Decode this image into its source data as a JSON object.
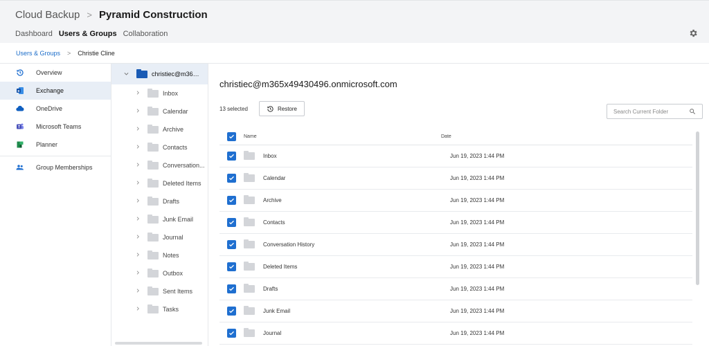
{
  "header": {
    "app_title": "Cloud Backup",
    "separator": ">",
    "org_name": "Pyramid Construction",
    "nav": [
      {
        "label": "Dashboard",
        "active": false
      },
      {
        "label": "Users & Groups",
        "active": true
      },
      {
        "label": "Collaboration",
        "active": false
      }
    ],
    "settings_icon": "gear-icon"
  },
  "breadcrumb": {
    "root": "Users & Groups",
    "separator": ">",
    "current": "Christie Cline"
  },
  "sidebar": {
    "items": [
      {
        "label": "Overview",
        "icon": "history-icon",
        "active": false
      },
      {
        "label": "Exchange",
        "icon": "exchange-icon",
        "active": true
      },
      {
        "label": "OneDrive",
        "icon": "cloud-icon",
        "active": false
      },
      {
        "label": "Microsoft Teams",
        "icon": "teams-icon",
        "active": false
      },
      {
        "label": "Planner",
        "icon": "planner-icon",
        "active": false
      }
    ],
    "secondary": [
      {
        "label": "Group Memberships",
        "icon": "people-icon",
        "active": false
      }
    ]
  },
  "tree": {
    "root_label": "christiec@m365...",
    "folders": [
      "Inbox",
      "Calendar",
      "Archive",
      "Contacts",
      "Conversation...",
      "Deleted Items",
      "Drafts",
      "Junk Email",
      "Journal",
      "Notes",
      "Outbox",
      "Sent Items",
      "Tasks"
    ]
  },
  "main": {
    "title": "christiec@m365x49430496.onmicrosoft.com",
    "selected_count": "13 selected",
    "restore_label": "Restore",
    "search_placeholder": "Search Current Folder",
    "columns": {
      "name": "Name",
      "date": "Date"
    },
    "rows": [
      {
        "name": "Inbox",
        "date": "Jun 19, 2023 1:44 PM"
      },
      {
        "name": "Calendar",
        "date": "Jun 19, 2023 1:44 PM"
      },
      {
        "name": "Archive",
        "date": "Jun 19, 2023 1:44 PM"
      },
      {
        "name": "Contacts",
        "date": "Jun 19, 2023 1:44 PM"
      },
      {
        "name": "Conversation History",
        "date": "Jun 19, 2023 1:44 PM"
      },
      {
        "name": "Deleted Items",
        "date": "Jun 19, 2023 1:44 PM"
      },
      {
        "name": "Drafts",
        "date": "Jun 19, 2023 1:44 PM"
      },
      {
        "name": "Junk Email",
        "date": "Jun 19, 2023 1:44 PM"
      },
      {
        "name": "Journal",
        "date": "Jun 19, 2023 1:44 PM"
      }
    ]
  },
  "colors": {
    "accent": "#1f6fd0",
    "link": "#1a6cc9",
    "active_bg": "#e8eef6",
    "header_bg": "#f3f4f6",
    "folder_gray": "#d3d5d9",
    "folder_blue": "#1a5bb5"
  }
}
